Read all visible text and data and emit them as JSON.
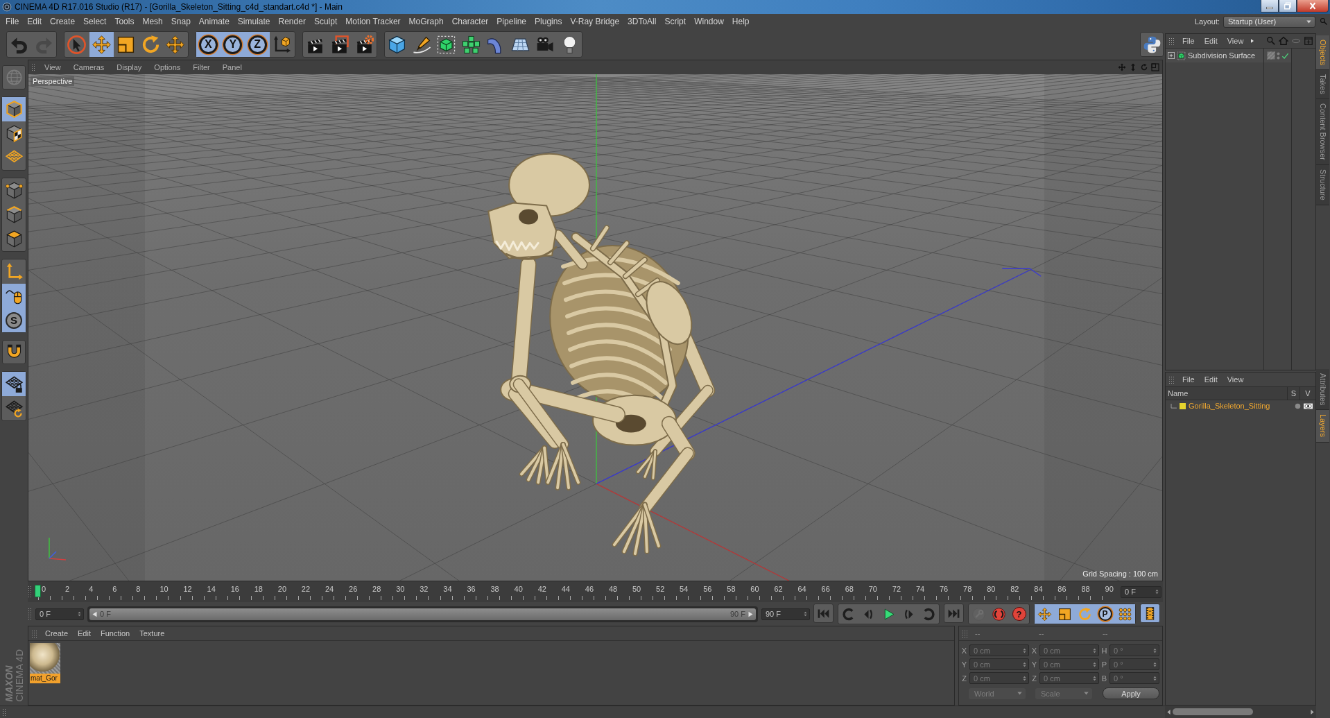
{
  "window": {
    "title": "CINEMA 4D R17.016 Studio (R17) - [Gorilla_Skeleton_Sitting_c4d_standart.c4d *] - Main"
  },
  "menu_bar": {
    "items": [
      "File",
      "Edit",
      "Create",
      "Select",
      "Tools",
      "Mesh",
      "Snap",
      "Animate",
      "Simulate",
      "Render",
      "Sculpt",
      "Motion Tracker",
      "MoGraph",
      "Character",
      "Pipeline",
      "Plugins",
      "V-Ray Bridge",
      "3DToAll",
      "Script",
      "Window",
      "Help"
    ],
    "layout_label": "Layout:",
    "layout_value": "Startup (User)"
  },
  "main_toolbar": {
    "groups": [
      [
        {
          "kind": "undo",
          "disabled": false
        },
        {
          "kind": "redo",
          "disabled": true
        }
      ],
      [
        {
          "kind": "live-select",
          "on": false
        },
        {
          "kind": "move",
          "on": true
        },
        {
          "kind": "scale",
          "on": false
        },
        {
          "kind": "rotate",
          "on": false
        },
        {
          "kind": "recent-tool",
          "on": false
        }
      ],
      [
        {
          "kind": "axis-lock",
          "label": "X",
          "on": true
        },
        {
          "kind": "axis-lock",
          "label": "Y",
          "on": true
        },
        {
          "kind": "axis-lock",
          "label": "Z",
          "on": true
        },
        {
          "kind": "coord-system",
          "on": false
        }
      ],
      [
        {
          "kind": "render-view"
        },
        {
          "kind": "render-picture"
        },
        {
          "kind": "render-settings"
        }
      ],
      [
        {
          "kind": "cube"
        },
        {
          "kind": "pen"
        },
        {
          "kind": "subdivision"
        },
        {
          "kind": "cloner"
        },
        {
          "kind": "bend"
        },
        {
          "kind": "floor"
        },
        {
          "kind": "camera"
        },
        {
          "kind": "light"
        }
      ]
    ]
  },
  "mode_toolbar": {
    "groups": [
      [
        {
          "kind": "make-editable",
          "disabled": true
        }
      ],
      [
        {
          "kind": "model",
          "on": true
        },
        {
          "kind": "texture",
          "on": false
        },
        {
          "kind": "workplane",
          "on": false
        }
      ],
      [
        {
          "kind": "points",
          "on": false
        },
        {
          "kind": "edges",
          "on": false
        },
        {
          "kind": "polygons",
          "on": false
        }
      ],
      [
        {
          "kind": "axis",
          "on": false
        },
        {
          "kind": "tweak",
          "on": true
        },
        {
          "kind": "solo",
          "label": "S",
          "on": true
        }
      ],
      [
        {
          "kind": "snap",
          "on": false
        }
      ],
      [
        {
          "kind": "workplane-lock",
          "on": true
        },
        {
          "kind": "locked-workplane",
          "on": false
        }
      ]
    ]
  },
  "viewport": {
    "menu": [
      "View",
      "Cameras",
      "Display",
      "Options",
      "Filter",
      "Panel"
    ],
    "camera": "Perspective",
    "grid_spacing": "Grid Spacing : 100 cm"
  },
  "timeline": {
    "labels": [
      "0",
      "2",
      "4",
      "6",
      "8",
      "10",
      "12",
      "14",
      "16",
      "18",
      "20",
      "22",
      "24",
      "26",
      "28",
      "30",
      "32",
      "34",
      "36",
      "38",
      "40",
      "42",
      "44",
      "46",
      "48",
      "50",
      "52",
      "54",
      "56",
      "58",
      "60",
      "62",
      "64",
      "66",
      "68",
      "70",
      "72",
      "74",
      "76",
      "78",
      "80",
      "82",
      "84",
      "86",
      "88",
      "90"
    ],
    "level": 0,
    "frame_field": "0 F"
  },
  "transport": {
    "start_field": "0 F",
    "range": {
      "start_label": "0 F",
      "end_label": "90 F",
      "level": 1
    },
    "end_field": "90 F",
    "groups": [
      [
        {
          "kind": "go-start"
        }
      ],
      [
        {
          "kind": "prev-key"
        },
        {
          "kind": "prev-frame"
        },
        {
          "kind": "play"
        },
        {
          "kind": "next-frame"
        },
        {
          "kind": "next-key"
        }
      ],
      [
        {
          "kind": "go-end"
        }
      ],
      [
        {
          "kind": "autokey",
          "disabled": true
        },
        {
          "kind": "record",
          "disabled": false
        },
        {
          "kind": "key-selection",
          "label": "?",
          "disabled": false
        }
      ],
      [
        {
          "kind": "key-move",
          "on": true
        },
        {
          "kind": "key-scale",
          "on": true
        },
        {
          "kind": "key-rotate",
          "on": true
        },
        {
          "kind": "key-param",
          "label": "P",
          "on": true
        },
        {
          "kind": "key-points",
          "on": true
        }
      ],
      [
        {
          "kind": "timeline-window",
          "on": true
        }
      ]
    ]
  },
  "material_manager": {
    "menu": [
      "Create",
      "Edit",
      "Function",
      "Texture"
    ],
    "materials": [
      {
        "name": "mat_Gor",
        "selected": true
      }
    ]
  },
  "coordinates": {
    "headers": [
      "--",
      "--",
      "--"
    ],
    "rows": [
      [
        {
          "axis": "X",
          "value": "0 cm"
        },
        {
          "axis": "X",
          "value": "0 cm"
        },
        {
          "axis": "H",
          "value": "0 °"
        }
      ],
      [
        {
          "axis": "Y",
          "value": "0 cm"
        },
        {
          "axis": "Y",
          "value": "0 cm"
        },
        {
          "axis": "P",
          "value": "0 °"
        }
      ],
      [
        {
          "axis": "Z",
          "value": "0 cm"
        },
        {
          "axis": "Z",
          "value": "0 cm"
        },
        {
          "axis": "B",
          "value": "0 °"
        }
      ]
    ],
    "dropdowns": [
      {
        "value": "World",
        "disabled": true
      },
      {
        "value": "Scale",
        "disabled": true
      }
    ],
    "apply": "Apply"
  },
  "logo": {
    "brand": "MAXON",
    "product": "CINEMA 4D"
  },
  "object_manager": {
    "menu": [
      "File",
      "Edit",
      "View"
    ],
    "objects": [
      {
        "name": "Subdivision Surface",
        "expanded": false,
        "enabled": true
      }
    ]
  },
  "layer_manager": {
    "menu": [
      "File",
      "Edit",
      "View"
    ],
    "columns": [
      "Name",
      "S",
      "V"
    ],
    "layers": [
      {
        "name": "Gorilla_Skeleton_Sitting",
        "color": "#e6d42e",
        "solo": false,
        "visible": true
      }
    ]
  },
  "side_tabs": {
    "upper": [
      {
        "label": "Objects",
        "selected": true
      },
      {
        "label": "Takes",
        "selected": false
      },
      {
        "label": "Content Browser",
        "selected": false
      },
      {
        "label": "Structure",
        "selected": false
      }
    ],
    "lower": [
      {
        "label": "Attributes",
        "selected": false
      },
      {
        "label": "Layers",
        "selected": true
      }
    ]
  }
}
